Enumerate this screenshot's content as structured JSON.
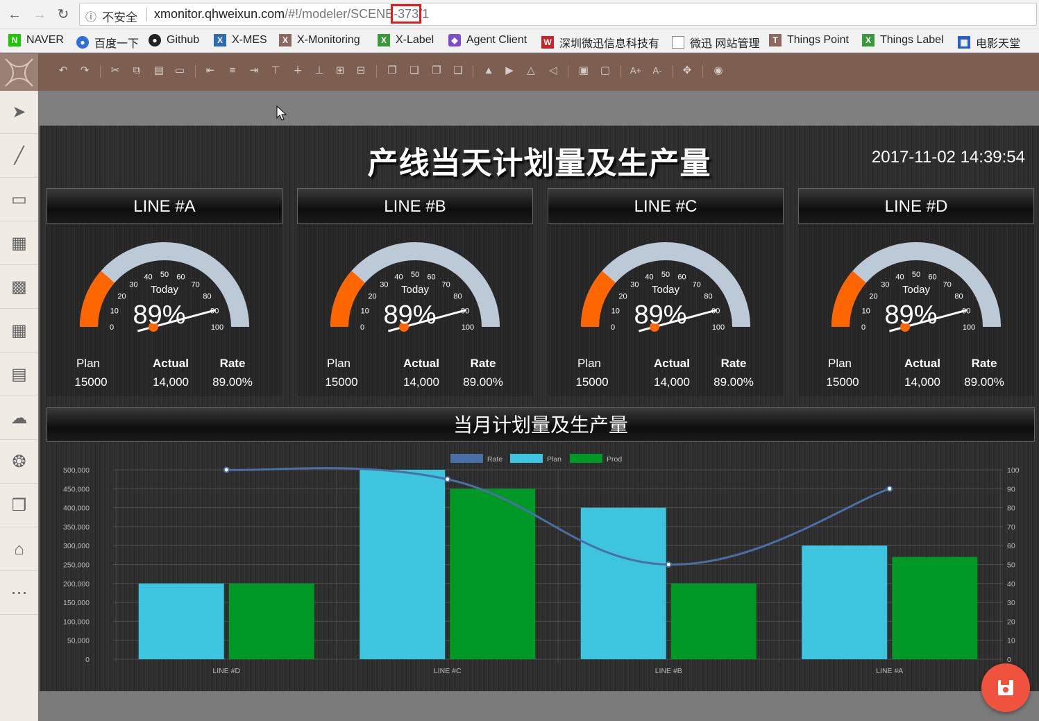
{
  "browser": {
    "insecure_label": "不安全",
    "url_host": "xmonitor.qhweixun.com",
    "url_path_pre": "/#!/modeler/SCENE",
    "url_path_hl": "-373",
    "url_path_post": "/1",
    "bookmarks": [
      "NAVER",
      "百度一下",
      "Github",
      "X-MES",
      "X-Monitoring",
      "X-Label",
      "Agent Client",
      "深圳微迅信息科技有",
      "微迅 网站管理",
      "Things Point",
      "Things Label",
      "电影天堂"
    ]
  },
  "dashboard": {
    "title": "产线当天计划量及生产量",
    "datetime": "2017-11-02 14:39:54",
    "panels": [
      {
        "name": "LINE #A",
        "today_label": "Today",
        "percent": "89%",
        "plan_label": "Plan",
        "actual_label": "Actual",
        "rate_label": "Rate",
        "plan": "15000",
        "actual": "14,000",
        "rate": "89.00%",
        "gauge_value": 23
      },
      {
        "name": "LINE #B",
        "today_label": "Today",
        "percent": "89%",
        "plan_label": "Plan",
        "actual_label": "Actual",
        "rate_label": "Rate",
        "plan": "15000",
        "actual": "14,000",
        "rate": "89.00%",
        "gauge_value": 23
      },
      {
        "name": "LINE #C",
        "today_label": "Today",
        "percent": "89%",
        "plan_label": "Plan",
        "actual_label": "Actual",
        "rate_label": "Rate",
        "plan": "15000",
        "actual": "14,000",
        "rate": "89.00%",
        "gauge_value": 23
      },
      {
        "name": "LINE #D",
        "today_label": "Today",
        "percent": "89%",
        "plan_label": "Plan",
        "actual_label": "Actual",
        "rate_label": "Rate",
        "plan": "15000",
        "actual": "14,000",
        "rate": "89.00%",
        "gauge_value": 23
      }
    ],
    "gauge_ticks": [
      "0",
      "10",
      "20",
      "30",
      "40",
      "50",
      "60",
      "70",
      "80",
      "90",
      "100"
    ],
    "needle_value": 89,
    "chart_title": "当月计划量及生产量"
  },
  "colors": {
    "gauge_fill": "#ff6600",
    "gauge_track": "#bccad8",
    "plan": "#3dc4de",
    "prod": "#009926",
    "rate": "#4a6fa5",
    "save": "#f0533d"
  },
  "chart_data": {
    "type": "bar",
    "categories": [
      "LINE #D",
      "LINE #C",
      "LINE #B",
      "LINE #A"
    ],
    "series": [
      {
        "name": "Plan",
        "values": [
          200000,
          500000,
          400000,
          300000
        ]
      },
      {
        "name": "Prod",
        "values": [
          200000,
          450000,
          200000,
          270000
        ]
      },
      {
        "name": "Rate",
        "type": "line",
        "axis": "right",
        "values": [
          100,
          95,
          50,
          90
        ]
      }
    ],
    "legend": [
      "Rate",
      "Plan",
      "Prod"
    ],
    "legend_position": "top",
    "ylim": [
      0,
      500000
    ],
    "y_ticks": [
      "0",
      "50,000",
      "100,000",
      "150,000",
      "200,000",
      "250,000",
      "300,000",
      "350,000",
      "400,000",
      "450,000",
      "500,000"
    ],
    "y2lim": [
      0,
      100
    ],
    "y2_ticks": [
      "0",
      "10",
      "20",
      "30",
      "40",
      "50",
      "60",
      "70",
      "80",
      "90",
      "100"
    ],
    "grid": true
  }
}
